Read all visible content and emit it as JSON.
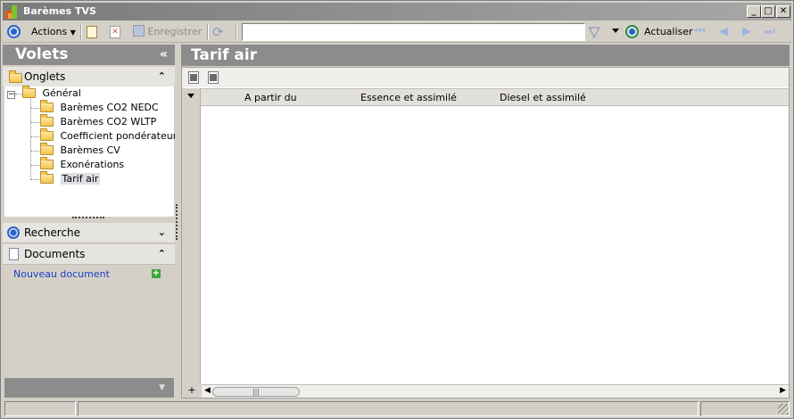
{
  "window": {
    "title": "Barèmes TVS"
  },
  "toolbar": {
    "actions_label": "Actions",
    "save_label": "Enregistrer",
    "search_value": "",
    "refresh_label": "Actualiser"
  },
  "left_panel": {
    "title": "Volets",
    "tabs_group": {
      "label": "Onglets"
    },
    "tree": {
      "root": "Général",
      "children": [
        {
          "label": "Barèmes CO2 NEDC"
        },
        {
          "label": "Barèmes CO2 WLTP"
        },
        {
          "label": "Coefficient pondérateur"
        },
        {
          "label": "Barèmes CV"
        },
        {
          "label": "Exonérations"
        },
        {
          "label": "Tarif air"
        }
      ],
      "selected": "Tarif air"
    },
    "search_group": {
      "label": "Recherche"
    },
    "documents_group": {
      "label": "Documents",
      "new_document": "Nouveau document"
    }
  },
  "main": {
    "title": "Tarif air",
    "columns": [
      "A partir du",
      "Essence et assimilé",
      "Diesel et assimilé"
    ],
    "rows": []
  },
  "icons": {
    "app": "app-logo-icon",
    "actions": "actions-circle-icon",
    "new": "new-document-icon",
    "delete": "delete-icon",
    "save": "save-icon",
    "sync": "sync-icon",
    "filter": "filter-icon",
    "refresh": "refresh-icon"
  },
  "colors": {
    "header_bg": "#8c8c8c",
    "link": "#1a3fc0",
    "window_bg": "#d4d0c8"
  }
}
